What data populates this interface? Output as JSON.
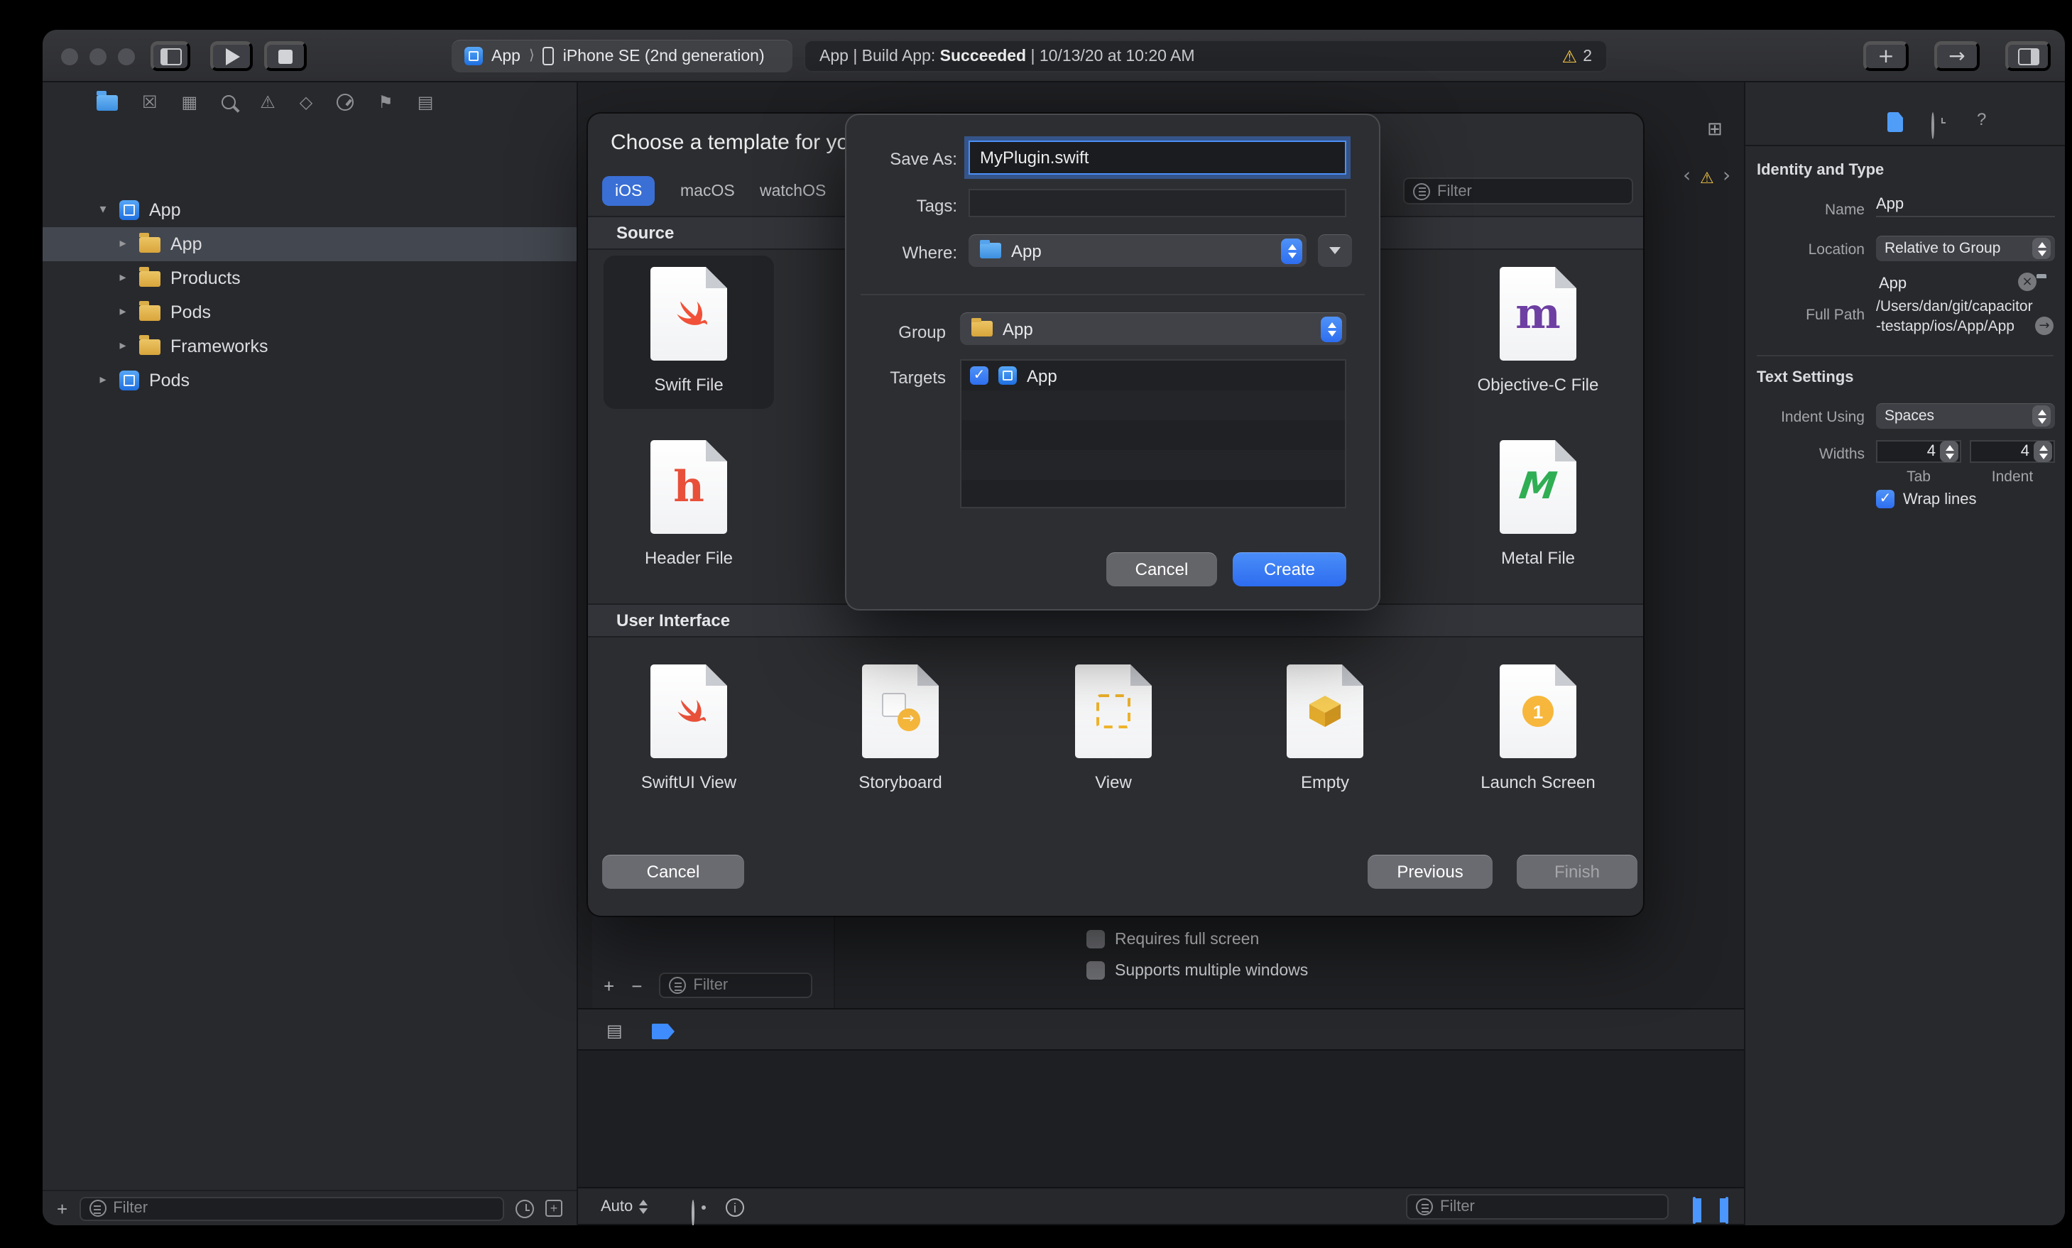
{
  "toolbar": {
    "scheme": {
      "project": "App",
      "separator": "⟩",
      "device": "iPhone SE (2nd generation)"
    },
    "status": {
      "prefix": "App | Build App: ",
      "status": "Succeeded",
      "suffix": " | 10/13/20 at 10:20 AM",
      "warning_count": "2"
    }
  },
  "navigator": {
    "tree": [
      {
        "label": "App"
      },
      {
        "label": "App"
      },
      {
        "label": "Products"
      },
      {
        "label": "Pods"
      },
      {
        "label": "Frameworks"
      },
      {
        "label": "Pods"
      }
    ],
    "filter_placeholder": "Filter"
  },
  "sheet": {
    "title": "Choose a template for your",
    "tabs": [
      {
        "label": "iOS"
      },
      {
        "label": "macOS"
      },
      {
        "label": "watchOS"
      }
    ],
    "filter_placeholder": "Filter",
    "sections": [
      {
        "name": "Source",
        "items": [
          {
            "label": "Swift File"
          },
          {
            "label": "Header File"
          },
          {
            "label": "Objective-C File"
          },
          {
            "label": "Metal File"
          }
        ]
      },
      {
        "name": "User Interface",
        "items": [
          {
            "label": "SwiftUI View"
          },
          {
            "label": "Storyboard"
          },
          {
            "label": "View"
          },
          {
            "label": "Empty"
          },
          {
            "label": "Launch Screen"
          }
        ]
      }
    ],
    "buttons": {
      "cancel": "Cancel",
      "previous": "Previous",
      "finish": "Finish"
    }
  },
  "dialog": {
    "save_as_label": "Save As:",
    "save_as_value": "MyPlugin.swift",
    "tags_label": "Tags:",
    "tags_value": "",
    "where_label": "Where:",
    "where_value": "App",
    "group_label": "Group",
    "group_value": "App",
    "targets_label": "Targets",
    "target_row": {
      "label": "App"
    },
    "buttons": {
      "cancel": "Cancel",
      "create": "Create"
    }
  },
  "editor": {
    "checkboxes": [
      {
        "label": "Requires full screen"
      },
      {
        "label": "Supports multiple windows"
      }
    ],
    "filter_placeholder": "Filter",
    "bottom_bar": {
      "auto_label": "Auto",
      "filter_placeholder": "Filter"
    }
  },
  "inspector": {
    "identity": {
      "header": "Identity and Type",
      "name_label": "Name",
      "name_value": "App",
      "location_label": "Location",
      "location_value": "Relative to Group",
      "file_name": "App",
      "full_path_label": "Full Path",
      "full_path_value": "/Users/dan/git/capacitor-testapp/ios/App/App"
    },
    "text_settings": {
      "header": "Text Settings",
      "indent_label": "Indent Using",
      "indent_value": "Spaces",
      "widths_label": "Widths",
      "tab_value": "4",
      "tab_label": "Tab",
      "indent_value2": "4",
      "indent_label2": "Indent",
      "wrap_label": "Wrap lines"
    }
  }
}
